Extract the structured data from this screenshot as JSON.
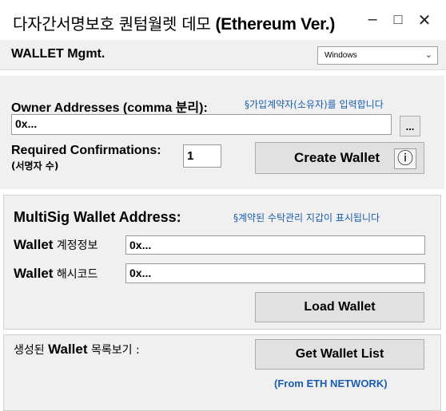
{
  "window": {
    "title_prefix": "다자간서명보호 퀀텀월렛 데모 ",
    "title_suffix": "(Ethereum Ver.)",
    "minimize_glyph": "–",
    "maximize_glyph": "□",
    "close_glyph": "✕"
  },
  "menu": {
    "title": "WALLET Mgmt.",
    "theme_select": {
      "value": "Windows",
      "caret": "⌄"
    }
  },
  "owners": {
    "label": "Owner Addresses (comma 분리):",
    "hint": "§가입계약자(소유자)를 입력합니다",
    "value": "0x...",
    "browse_label": "..."
  },
  "confirmations": {
    "label": "Required Confirmations:",
    "sublabel": "(서명자 수)",
    "value": "1"
  },
  "create_button": {
    "label": "Create Wallet",
    "info_glyph": "ⓘ"
  },
  "multisig": {
    "heading": "MultiSig Wallet Address:",
    "hint": "§계약된 수탁관리 지갑이 표시됩니다",
    "account_label_en": "Wallet",
    "account_label_ko": " 계정정보",
    "account_value": "0x...",
    "hash_label_en": "Wallet",
    "hash_label_ko": " 해시코드",
    "hash_value": "0x...",
    "load_button": "Load Wallet"
  },
  "list": {
    "label_ko_prefix": "생성된 ",
    "label_en": "Wallet",
    "label_ko_suffix": " 목록보기 :",
    "button": "Get Wallet List",
    "source_note": "(From ETH NETWORK)"
  }
}
